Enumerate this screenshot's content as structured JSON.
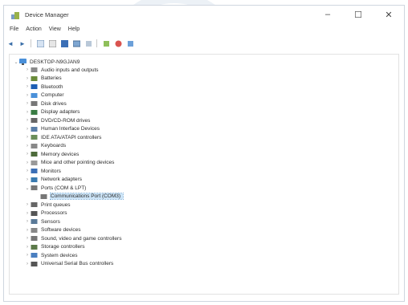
{
  "window": {
    "title": "Device Manager",
    "minimize_glyph": "–",
    "maximize_glyph": "☐",
    "close_glyph": "✕"
  },
  "menu": [
    "File",
    "Action",
    "View",
    "Help"
  ],
  "toolbar": [
    "back-icon",
    "forward-icon",
    "properties-icon",
    "view-icon",
    "help-icon",
    "scan-icon",
    "device-icon",
    "update-driver-icon",
    "disable-icon",
    "uninstall-icon"
  ],
  "tree": {
    "root": "DESKTOP-N9GJAN9",
    "items": [
      {
        "label": "Audio inputs and outputs",
        "icon": "audio-icon",
        "color": "#8a8a8a"
      },
      {
        "label": "Batteries",
        "icon": "battery-icon",
        "color": "#6a8b3a"
      },
      {
        "label": "Bluetooth",
        "icon": "bluetooth-icon",
        "color": "#1e5fb4"
      },
      {
        "label": "Computer",
        "icon": "computer-icon",
        "color": "#4a90d9"
      },
      {
        "label": "Disk drives",
        "icon": "disk-icon",
        "color": "#777"
      },
      {
        "label": "Display adapters",
        "icon": "display-icon",
        "color": "#3a7d44"
      },
      {
        "label": "DVD/CD-ROM drives",
        "icon": "dvd-icon",
        "color": "#666"
      },
      {
        "label": "Human Interface Devices",
        "icon": "hid-icon",
        "color": "#5a7fa8"
      },
      {
        "label": "IDE ATA/ATAPI controllers",
        "icon": "ide-icon",
        "color": "#6b8e5a"
      },
      {
        "label": "Keyboards",
        "icon": "keyboard-icon",
        "color": "#888"
      },
      {
        "label": "Memory devices",
        "icon": "memory-icon",
        "color": "#4d6b3b"
      },
      {
        "label": "Mice and other pointing devices",
        "icon": "mouse-icon",
        "color": "#999"
      },
      {
        "label": "Monitors",
        "icon": "monitor-icon",
        "color": "#3b6fb6"
      },
      {
        "label": "Network adapters",
        "icon": "network-icon",
        "color": "#3a7bb0"
      },
      {
        "label": "Ports (COM & LPT)",
        "icon": "port-icon",
        "color": "#777",
        "expanded": true
      },
      {
        "label": "Communications Port (COM3)",
        "icon": "port-icon",
        "color": "#777",
        "child": true,
        "selected": true
      },
      {
        "label": "Print queues",
        "icon": "printer-icon",
        "color": "#666"
      },
      {
        "label": "Processors",
        "icon": "processor-icon",
        "color": "#555"
      },
      {
        "label": "Sensors",
        "icon": "sensor-icon",
        "color": "#5a7a98"
      },
      {
        "label": "Software devices",
        "icon": "software-icon",
        "color": "#888"
      },
      {
        "label": "Sound, video and game controllers",
        "icon": "sound-icon",
        "color": "#777"
      },
      {
        "label": "Storage controllers",
        "icon": "storage-icon",
        "color": "#5c7a4a"
      },
      {
        "label": "System devices",
        "icon": "system-icon",
        "color": "#4a7fc0"
      },
      {
        "label": "Universal Serial Bus controllers",
        "icon": "usb-icon",
        "color": "#555"
      }
    ]
  }
}
